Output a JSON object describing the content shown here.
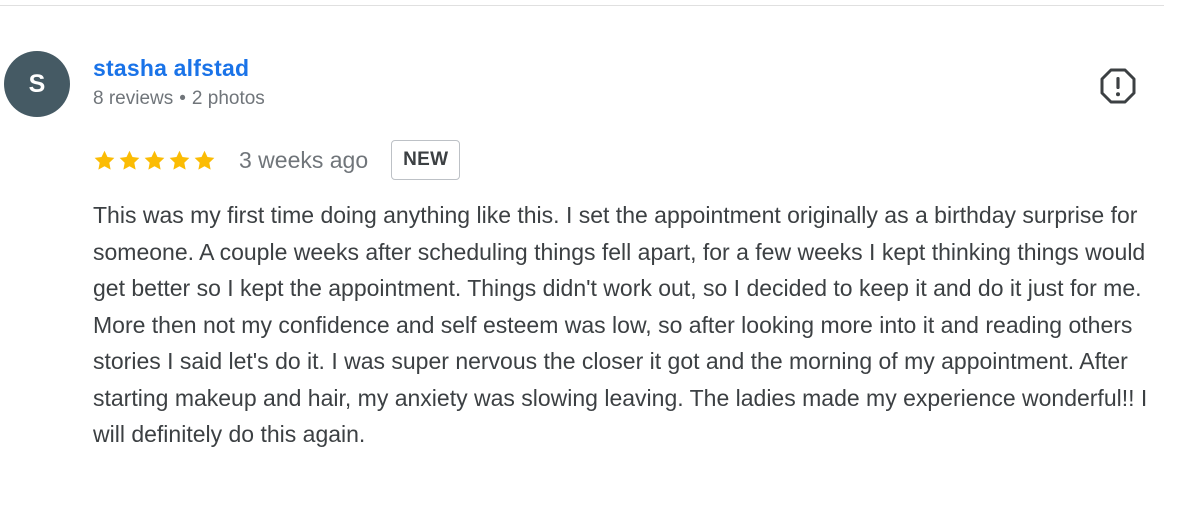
{
  "review": {
    "author": {
      "initial": "S",
      "name": "stasha alfstad",
      "reviews": "8 reviews",
      "separator": "•",
      "photos": "2 photos",
      "avatar_color": "#455a64"
    },
    "rating": 5,
    "rating_max": 5,
    "star_color": "#fbbc04",
    "time_ago": "3 weeks ago",
    "badge": "NEW",
    "text": "This was my first time doing anything like this. I set the appointment originally as a birthday surprise for someone. A couple weeks after scheduling things fell apart, for a few weeks I kept thinking things would get better so I kept the appointment. Things didn't work out, so I decided to keep it and do it just for me. More then not my confidence and self esteem was low, so after looking more into it and reading others stories I said let's do it. I was super nervous the closer it got and the morning of my appointment. After starting makeup and hair, my anxiety was slowing leaving. The ladies made my experience wonderful!! I will definitely do this again.",
    "flag_icon": "report-flag-icon"
  },
  "colors": {
    "link": "#1a73e8",
    "secondary_text": "#70757a",
    "body_text": "#3c4043"
  }
}
